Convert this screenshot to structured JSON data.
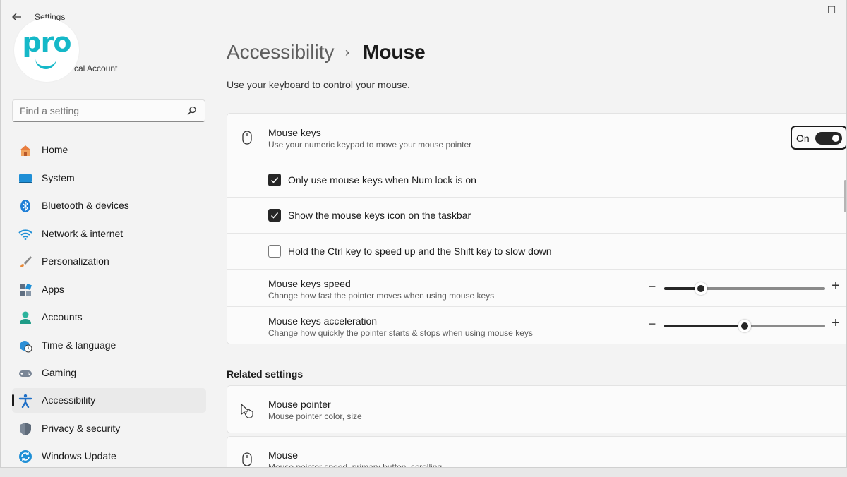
{
  "window": {
    "title": "Settings",
    "back_icon": "arrow-left-icon",
    "minimize_glyph": "—",
    "maximize_glyph": "☐"
  },
  "logo": {
    "text": "pro"
  },
  "user": {
    "name": "s",
    "account_type": "cal Account"
  },
  "search": {
    "placeholder": "Find a setting"
  },
  "nav": {
    "items": [
      {
        "label": "Home",
        "icon": "home-icon"
      },
      {
        "label": "System",
        "icon": "system-icon"
      },
      {
        "label": "Bluetooth & devices",
        "icon": "bluetooth-icon"
      },
      {
        "label": "Network & internet",
        "icon": "wifi-icon"
      },
      {
        "label": "Personalization",
        "icon": "brush-icon"
      },
      {
        "label": "Apps",
        "icon": "apps-icon"
      },
      {
        "label": "Accounts",
        "icon": "person-icon"
      },
      {
        "label": "Time & language",
        "icon": "globe-clock-icon"
      },
      {
        "label": "Gaming",
        "icon": "gamepad-icon"
      },
      {
        "label": "Accessibility",
        "icon": "accessibility-icon",
        "active": true
      },
      {
        "label": "Privacy & security",
        "icon": "shield-icon"
      },
      {
        "label": "Windows Update",
        "icon": "update-icon"
      }
    ]
  },
  "breadcrumb": {
    "parent": "Accessibility",
    "separator": "›",
    "current": "Mouse"
  },
  "page": {
    "description": "Use your keyboard to control your mouse."
  },
  "mouse_keys": {
    "title": "Mouse keys",
    "subtitle": "Use your numeric keypad to move your mouse pointer",
    "toggle_label": "On",
    "toggle_on": true,
    "options": [
      {
        "label": "Only use mouse keys when Num lock is on",
        "checked": true
      },
      {
        "label": "Show the mouse keys icon on the taskbar",
        "checked": true
      },
      {
        "label": "Hold the Ctrl key to speed up and the Shift key to slow down",
        "checked": false
      }
    ],
    "speed": {
      "title": "Mouse keys speed",
      "subtitle": "Change how fast the pointer moves when using mouse keys",
      "value_percent": 23,
      "minus": "−",
      "plus": "+"
    },
    "acceleration": {
      "title": "Mouse keys acceleration",
      "subtitle": "Change how quickly the pointer starts & stops when using mouse keys",
      "value_percent": 50,
      "minus": "−",
      "plus": "+"
    }
  },
  "related": {
    "title": "Related settings",
    "items": [
      {
        "title": "Mouse pointer",
        "subtitle": "Mouse pointer color, size",
        "icon": "mouse-pointer-icon"
      },
      {
        "title": "Mouse",
        "subtitle": "Mouse pointer speed, primary button, scrolling",
        "icon": "mouse-icon"
      }
    ]
  }
}
